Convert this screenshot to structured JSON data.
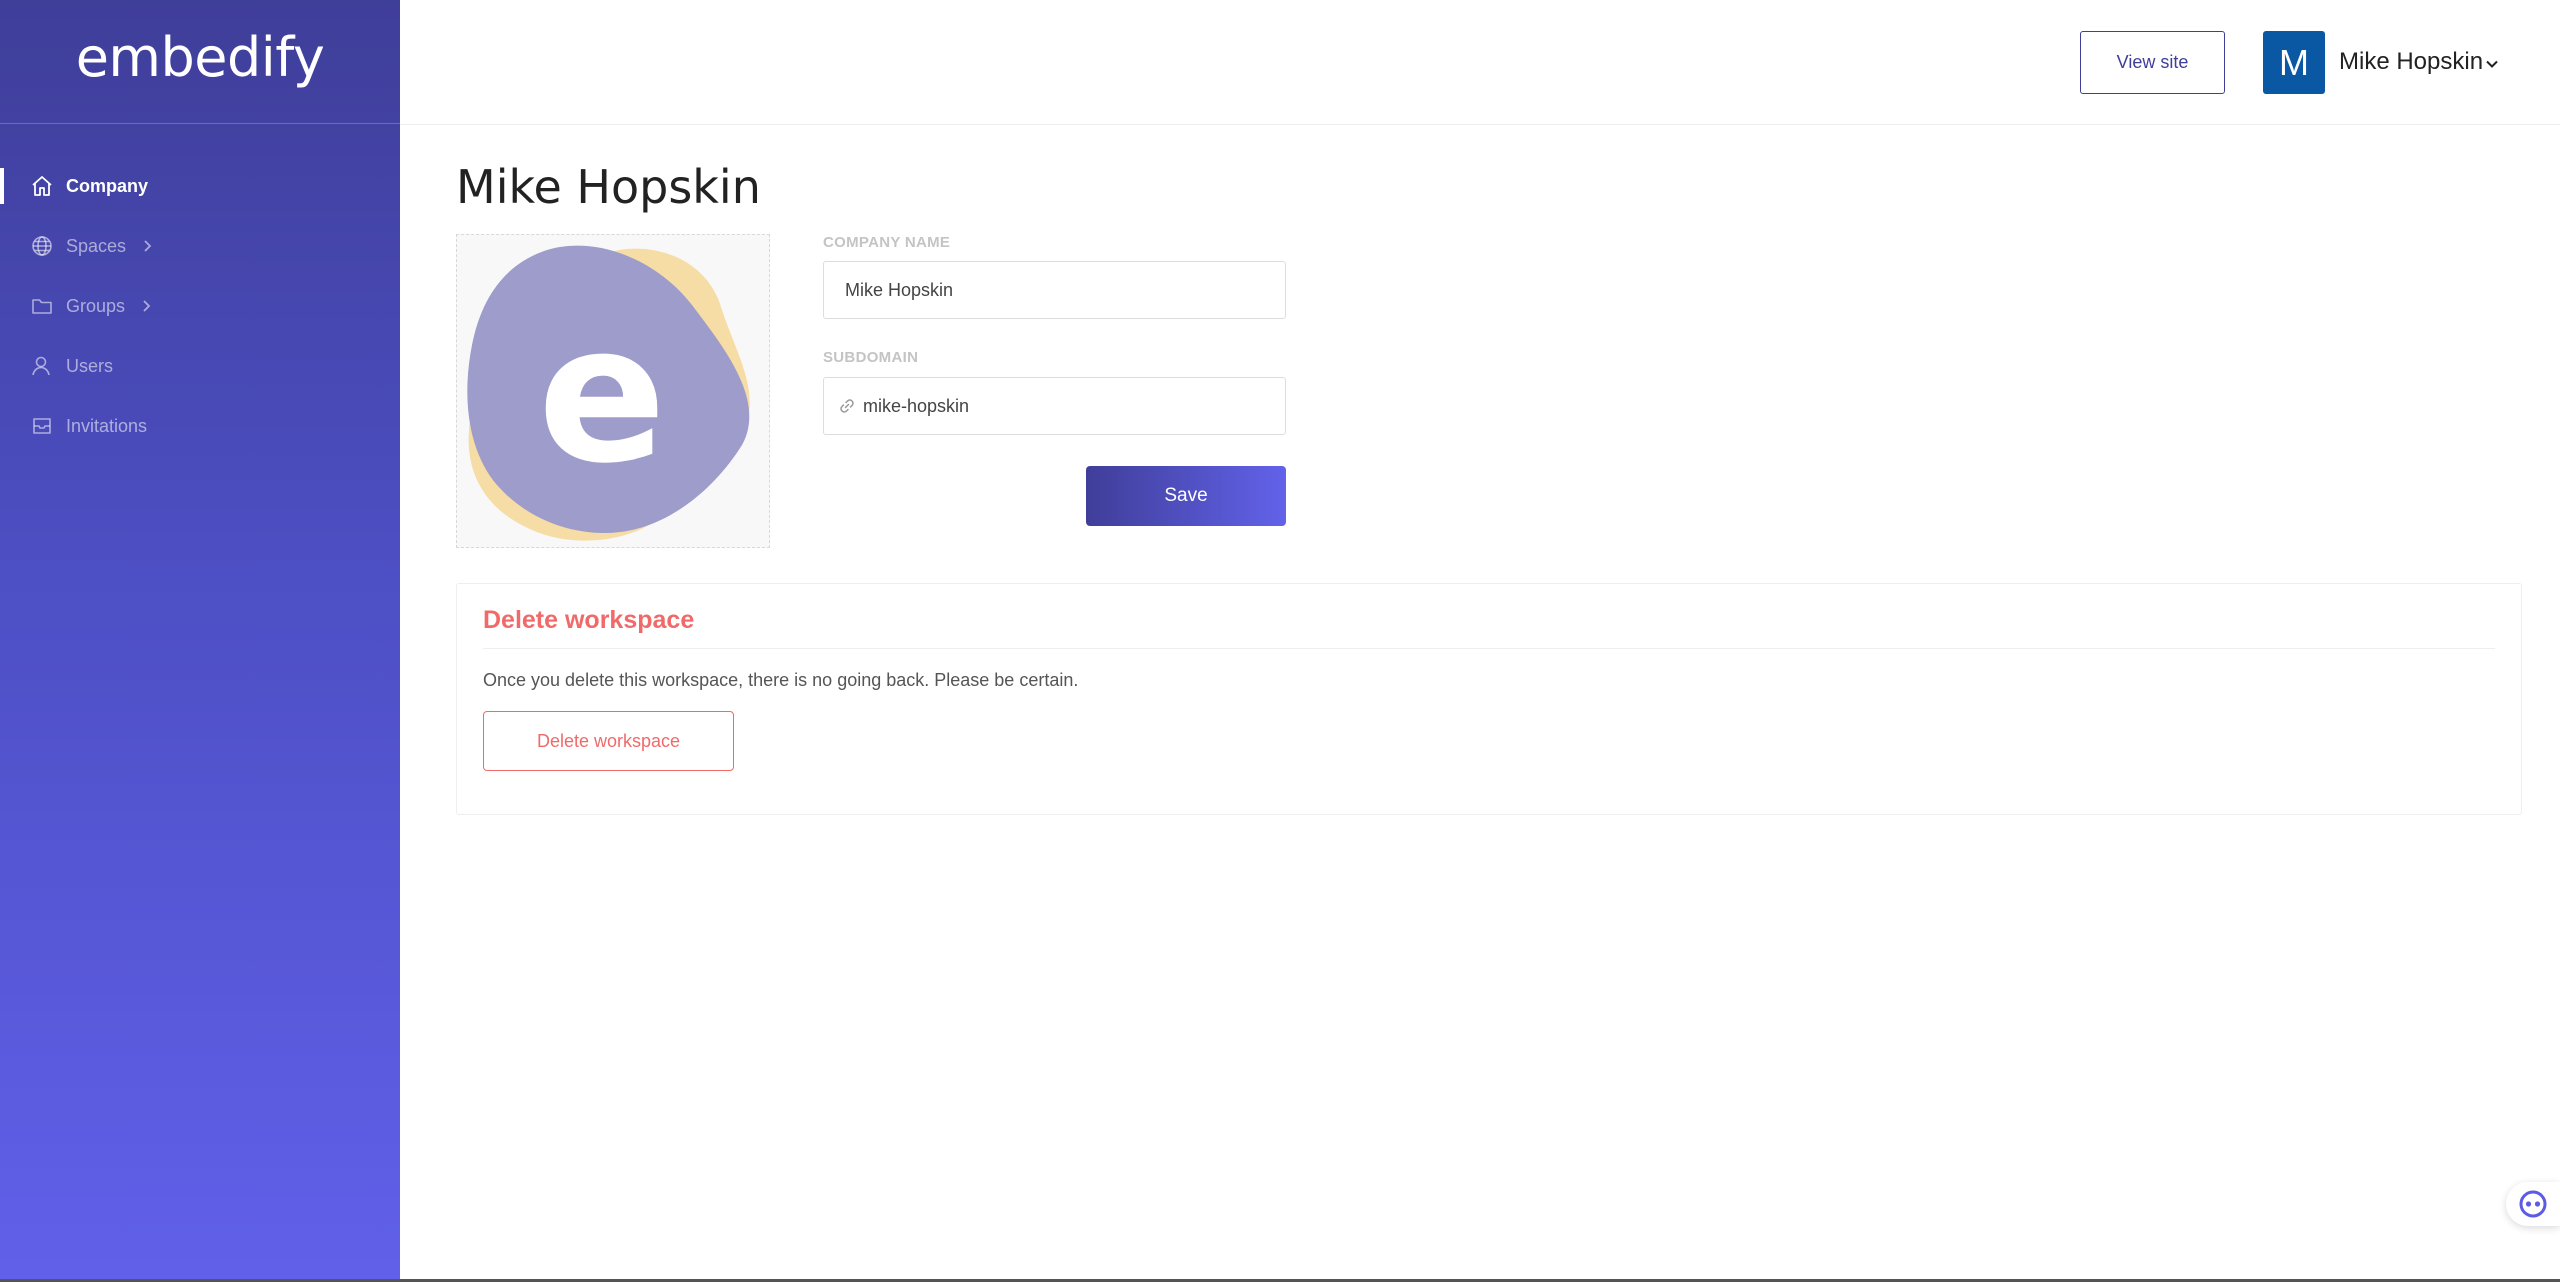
{
  "app": {
    "logo_text": "embedify"
  },
  "sidebar": {
    "items": [
      {
        "label": "Company",
        "icon": "home-icon",
        "active": true,
        "has_submenu": false
      },
      {
        "label": "Spaces",
        "icon": "globe-icon",
        "active": false,
        "has_submenu": true
      },
      {
        "label": "Groups",
        "icon": "folder-icon",
        "active": false,
        "has_submenu": true
      },
      {
        "label": "Users",
        "icon": "user-icon",
        "active": false,
        "has_submenu": false
      },
      {
        "label": "Invitations",
        "icon": "inbox-icon",
        "active": false,
        "has_submenu": false
      }
    ]
  },
  "header": {
    "view_site_label": "View site",
    "avatar_letter": "M",
    "user_name": "Mike Hopskin"
  },
  "main": {
    "page_title": "Mike Hopskin",
    "company_logo_letter": "e",
    "company_name_label": "Company name",
    "company_name_value": "Mike Hopskin",
    "subdomain_label": "Subdomain",
    "subdomain_value": "mike-hopskin",
    "save_label": "Save"
  },
  "danger_zone": {
    "title": "Delete workspace",
    "description": "Once you delete this workspace, there is no going back. Please be certain.",
    "button_label": "Delete workspace"
  },
  "colors": {
    "brand_dark": "#3f3e99",
    "brand_light": "#6060ea",
    "danger": "#f06a6a",
    "avatar_bg": "#0a57a3"
  }
}
